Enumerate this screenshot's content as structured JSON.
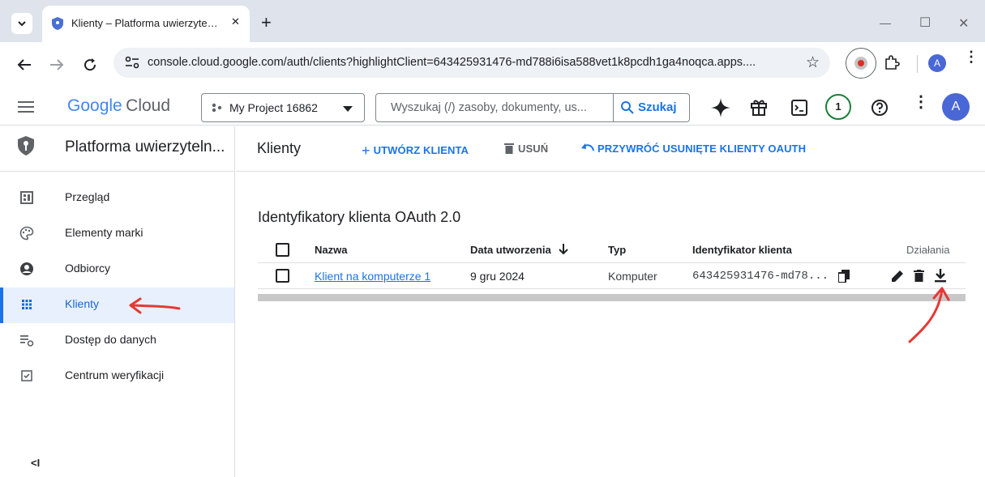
{
  "browser": {
    "tab_title": "Klienty – Platforma uwierzyte…",
    "new_tab_label": "+",
    "url": "console.cloud.google.com/auth/clients?highlightClient=643425931476-md788i6isa588vet1k8pcdh1ga4noqca.apps....",
    "profile_initial": "A",
    "minimize_label": "—",
    "maximize_label": "☐",
    "close_label": "✕"
  },
  "header": {
    "logo_google": "Google",
    "logo_cloud": "Cloud",
    "project_name": "My Project 16862",
    "search_placeholder": "Wyszukaj (/) zasoby, dokumenty, us...",
    "search_button": "Szukaj",
    "notifications_count": "1",
    "user_initial": "A"
  },
  "sidebar": {
    "title": "Platforma uwierzyteln...",
    "items": [
      {
        "label": "Przegląd",
        "icon": "dashboard-icon"
      },
      {
        "label": "Elementy marki",
        "icon": "palette-icon"
      },
      {
        "label": "Odbiorcy",
        "icon": "account-circle-icon"
      },
      {
        "label": "Klienty",
        "icon": "grid-icon",
        "active": true
      },
      {
        "label": "Dostęp do danych",
        "icon": "data-settings-icon"
      },
      {
        "label": "Centrum weryfikacji",
        "icon": "verify-icon"
      }
    ],
    "collapse_label": "<I"
  },
  "main": {
    "page_title": "Klienty",
    "actions": {
      "create": "UTWÓRZ KLIENTA",
      "delete": "USUŃ",
      "restore": "PRZYWRÓĆ USUNIĘTE KLIENTY OAUTH"
    },
    "section_title": "Identyfikatory klienta OAuth 2.0",
    "table": {
      "columns": [
        "Nazwa",
        "Data utworzenia",
        "Typ",
        "Identyfikator klienta",
        "Działania"
      ],
      "rows": [
        {
          "name": "Klient na komputerze 1",
          "created": "9 gru 2024",
          "type": "Komputer",
          "client_id": "643425931476-md78..."
        }
      ]
    }
  },
  "colors": {
    "accent": "#1a73e8",
    "annotation": "#e53935",
    "notification_ring": "#188038"
  }
}
